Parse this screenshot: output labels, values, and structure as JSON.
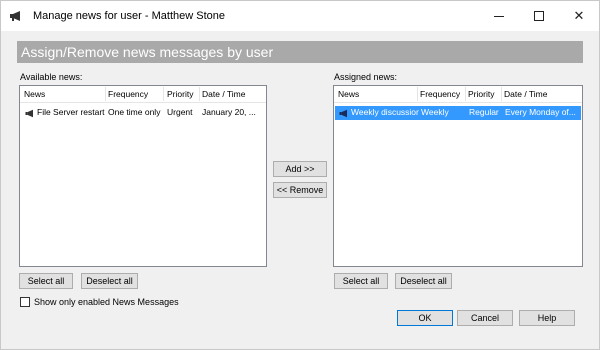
{
  "window": {
    "title": "Manage news for user - Matthew Stone"
  },
  "header": {
    "banner": "Assign/Remove news messages by user"
  },
  "available": {
    "label": "Available news:",
    "columns": [
      "News",
      "Frequency",
      "Priority",
      "Date / Time"
    ],
    "rows": [
      {
        "news": "File Server restart",
        "frequency": "One time only",
        "priority": "Urgent",
        "datetime": "January 20, ..."
      }
    ],
    "select_all": "Select all",
    "deselect_all": "Deselect all"
  },
  "assigned": {
    "label": "Assigned news:",
    "columns": [
      "News",
      "Frequency",
      "Priority",
      "Date / Time"
    ],
    "rows": [
      {
        "news": "Weekly discussion",
        "frequency": "Weekly",
        "priority": "Regular",
        "datetime": "Every Monday of...",
        "selected": true
      }
    ],
    "select_all": "Select all",
    "deselect_all": "Deselect all"
  },
  "actions": {
    "add": "Add >>",
    "remove": "<< Remove"
  },
  "options": {
    "show_enabled_only": "Show only enabled News Messages",
    "show_enabled_only_checked": false
  },
  "footer": {
    "ok": "OK",
    "cancel": "Cancel",
    "help": "Help"
  },
  "colors": {
    "banner": "#a9a9a9",
    "selection": "#3399ff"
  }
}
